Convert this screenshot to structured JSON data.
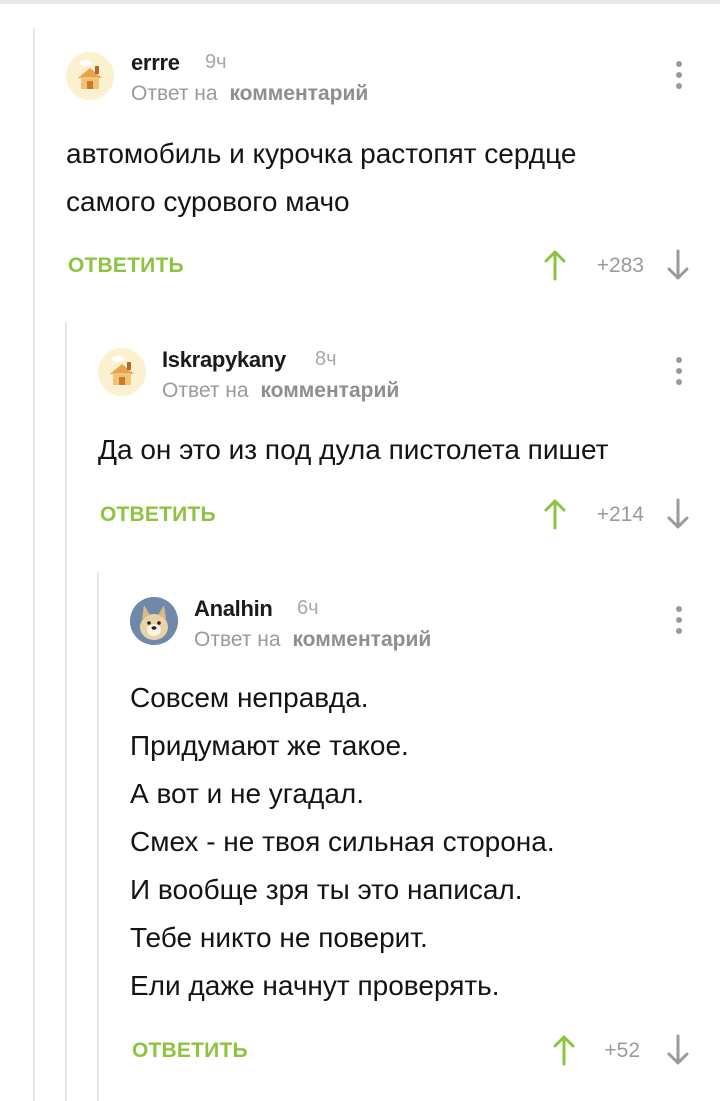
{
  "reply_to_prefix": "Ответ на",
  "reply_to_target": "комментарий",
  "reply_label": "ОТВЕТИТЬ",
  "colors": {
    "accent_green": "#8cc440",
    "text_muted": "#9a9a9a",
    "thread_line": "#e8e8e8"
  },
  "comments": [
    {
      "username": "errre",
      "time": "9ч",
      "avatar_icon": "house-avatar-icon",
      "lines": [
        "автомобиль и курочка растопят сердце",
        "самого сурового мачо"
      ],
      "score": "+283"
    },
    {
      "username": "Iskrapykany",
      "time": "8ч",
      "avatar_icon": "house-avatar-icon",
      "lines": [
        "Да он это из под дула пистолета пишет"
      ],
      "score": "+214"
    },
    {
      "username": "Analhin",
      "time": "6ч",
      "avatar_icon": "dog-avatar-icon",
      "lines": [
        "Совсем неправда.",
        "Придумают же такое.",
        "А вот и не угадал.",
        "Смех - не твоя сильная сторона.",
        "И вообще зря ты это написал.",
        "Тебе никто не поверит.",
        "Ели даже начнут проверять."
      ],
      "score": "+52"
    }
  ]
}
